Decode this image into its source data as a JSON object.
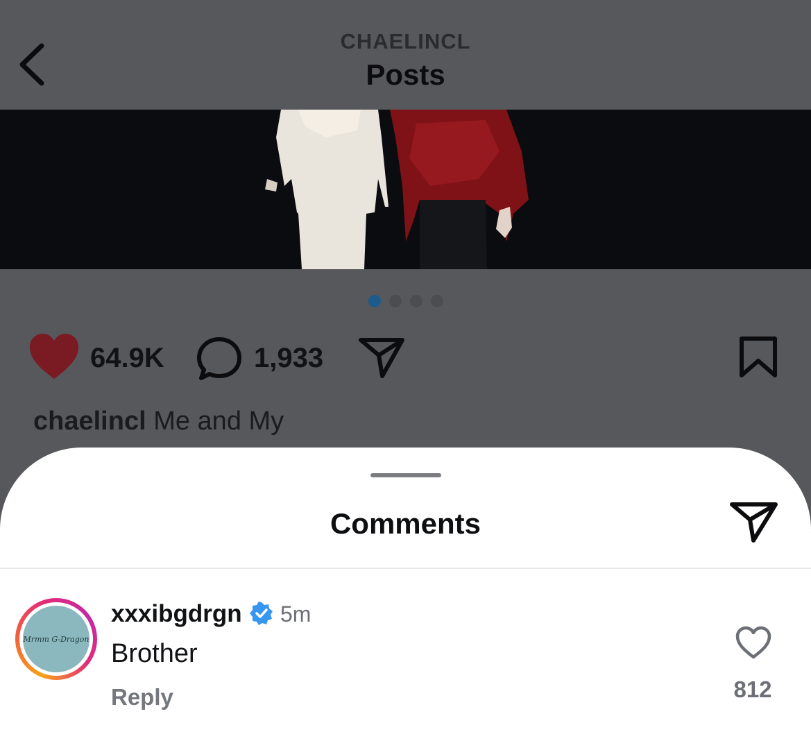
{
  "header": {
    "username": "CHAELINCL",
    "title": "Posts"
  },
  "carousel": {
    "page_count": 4,
    "active_page": 1
  },
  "post_actions": {
    "like_count": "64.9K",
    "comment_count": "1,933"
  },
  "caption": {
    "username": "chaelincl",
    "text": "Me and My"
  },
  "comments_sheet": {
    "title": "Comments"
  },
  "comment": {
    "username": "xxxibgdrgn",
    "time": "5m",
    "text": "Brother",
    "reply_label": "Reply",
    "like_count": "812",
    "avatar_text": "Mrmm G-Dragon"
  },
  "colors": {
    "overlay_background": "#57585c",
    "liked_heart": "#7a1a22",
    "active_dot": "#1c5b8c",
    "verified_badge": "#3797f0"
  }
}
